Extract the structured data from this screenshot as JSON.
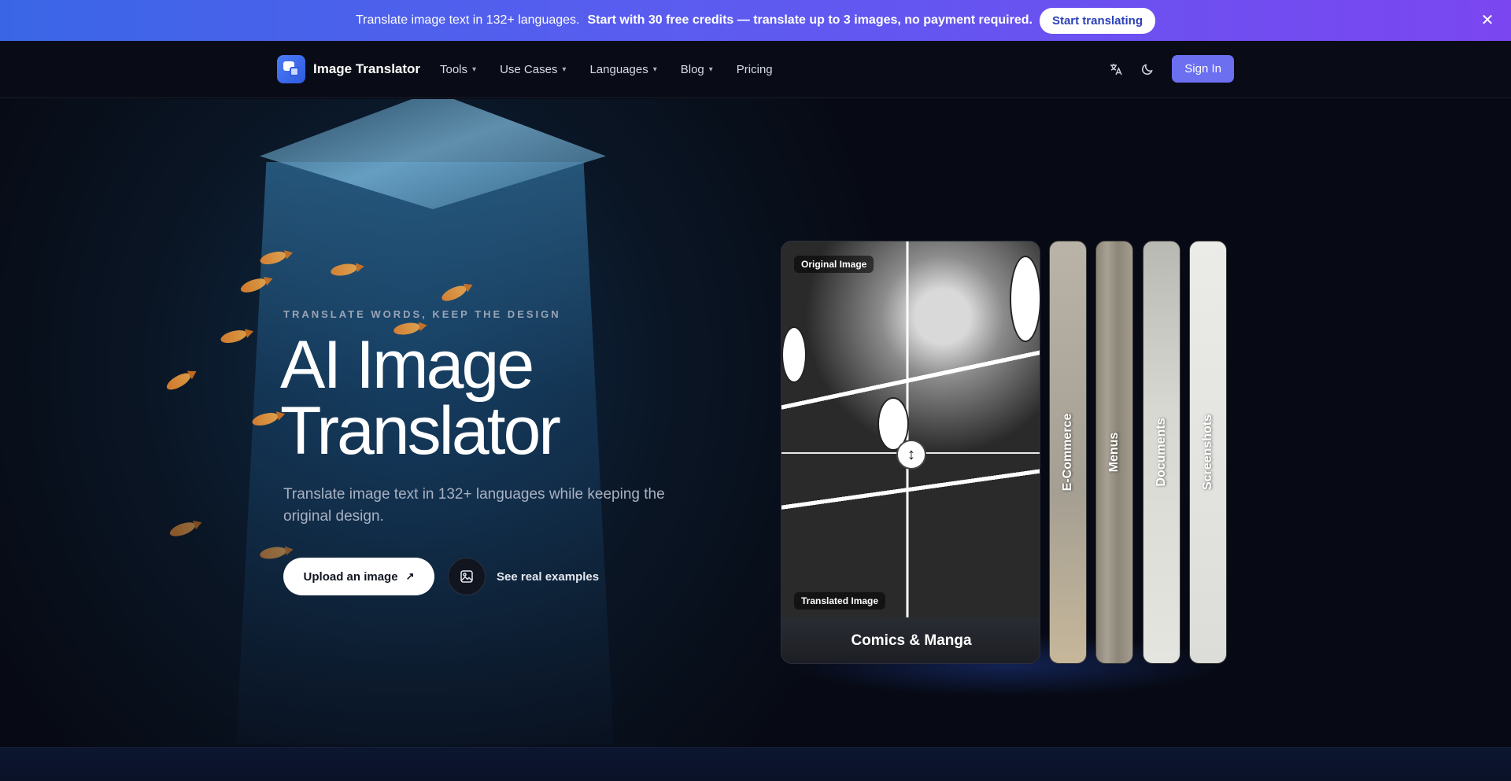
{
  "banner": {
    "text": "Translate image text in 132+ languages.",
    "strong": "Start with 30 free credits — translate up to 3 images, no payment required.",
    "cta": "Start translating",
    "close_icon": "close-icon"
  },
  "nav": {
    "brand": "Image Translator",
    "menu": [
      {
        "label": "Tools",
        "dropdown": true
      },
      {
        "label": "Use Cases",
        "dropdown": true
      },
      {
        "label": "Languages",
        "dropdown": true
      },
      {
        "label": "Blog",
        "dropdown": true
      },
      {
        "label": "Pricing",
        "dropdown": false
      }
    ],
    "language_icon": "translate-icon",
    "theme_icon": "moon-icon",
    "signin": "Sign In"
  },
  "hero": {
    "eyebrow": "TRANSLATE WORDS, KEEP THE DESIGN",
    "title_line1": "AI Image",
    "title_line2": "Translator",
    "subtitle": "Translate image text in 132+ languages while keeping the original design.",
    "upload": "Upload an image",
    "examples": "See real examples"
  },
  "showcase": {
    "main": {
      "caption": "Comics & Manga",
      "tag_original": "Original Image",
      "tag_translated": "Translated Image"
    },
    "cards": [
      {
        "label": "E-Commerce"
      },
      {
        "label": "Menus"
      },
      {
        "label": "Documents"
      },
      {
        "label": "Screenshots"
      }
    ]
  },
  "colors": {
    "banner_start": "#3a66e6",
    "banner_end": "#7b46f0",
    "signin_bg": "#6b6ff0",
    "page_bg": "#070a14"
  }
}
